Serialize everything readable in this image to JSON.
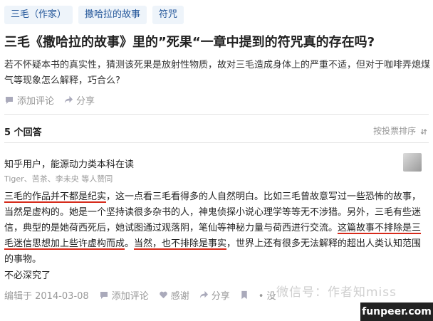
{
  "topics": [
    "三毛（作家）",
    "撒哈拉的故事",
    "符咒"
  ],
  "question": {
    "title": "三毛《撒哈拉的故事》里的”死果“一章中提到的符咒真的存在吗?",
    "detail": "若不怀疑本书的真实性，猜测该死果是放射性物质，故对三毛造成身体上的严重不适，但对于咖啡弄熄煤气等现象怎么解释，巧合么?",
    "actions": {
      "comment": "添加评论",
      "share": "分享"
    }
  },
  "answers_header": {
    "count": "5 个回答",
    "sort": "按投票排序"
  },
  "answer": {
    "author": "知乎用户，能源动力类本科在读",
    "voters": "Tiger、苦茶、李未央 等人赞同",
    "segments": [
      {
        "text": "三毛的作品并不都是纪实",
        "marked": true
      },
      {
        "text": "，这一点看三毛看得多的人自然明白。比如三毛曾故意写过一些恐怖的故事，当然是虚构的。她是一个坚持读很多杂书的人，神鬼侦探小说心理学等等无不涉猎。另外，三毛有些迷信，典型的是她荷西死后，她试图通过观落阴，笔仙等神秘力量与荷西进行交流。",
        "marked": false
      },
      {
        "text": "这篇故事不排除是三毛迷信思想加上些许虚构而成",
        "marked": true
      },
      {
        "text": "。",
        "marked": false
      },
      {
        "text": "当然，也不排除是事实",
        "marked": true
      },
      {
        "text": "，世界上还有很多无法解释的超出人类认知范围的事物。",
        "marked": false
      }
    ],
    "final_line": "不必深究了",
    "footer": {
      "edited": "编辑于 2014-03-08",
      "comment": "添加评论",
      "thanks": "感谢",
      "share": "分享",
      "collapsed": "• 没"
    }
  },
  "overlays": {
    "watermark": "微信号：作者知miss",
    "site_logo": "funpeer.com"
  },
  "colors": {
    "tag_bg": "#eef4fa",
    "tag_text": "#225599",
    "underline": "#d62a1a"
  }
}
